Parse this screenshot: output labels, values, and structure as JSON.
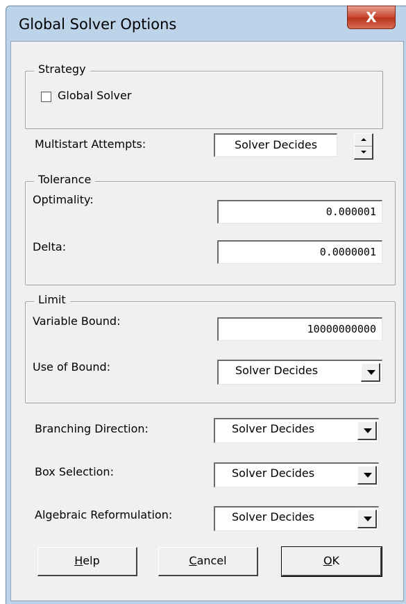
{
  "window": {
    "title": "Global Solver Options",
    "close_label": "X"
  },
  "strategy": {
    "legend": "Strategy",
    "global_solver_label": "Global Solver",
    "global_solver_checked": false
  },
  "multistart": {
    "label": "Multistart Attempts:",
    "value": "Solver Decides"
  },
  "tolerance": {
    "legend": "Tolerance",
    "optimality_label": "Optimality:",
    "optimality_value": "0.000001",
    "delta_label": "Delta:",
    "delta_value": "0.0000001"
  },
  "limit": {
    "legend": "Limit",
    "variable_bound_label": "Variable Bound:",
    "variable_bound_value": "10000000000",
    "use_of_bound_label": "Use of Bound:",
    "use_of_bound_value": "Solver Decides"
  },
  "branching": {
    "label": "Branching Direction:",
    "value": "Solver Decides"
  },
  "box_selection": {
    "label": "Box Selection:",
    "value": "Solver Decides"
  },
  "algebraic": {
    "label": "Algebraic Reformulation:",
    "value": "Solver Decides"
  },
  "buttons": {
    "help_first": "H",
    "help_rest": "elp",
    "cancel_first": "C",
    "cancel_rest": "ancel",
    "ok_first": "O",
    "ok_rest": "K"
  },
  "colors": {
    "frame": "#bdd3ea",
    "client": "#f0f0f0",
    "close_button": "#c8452d"
  }
}
